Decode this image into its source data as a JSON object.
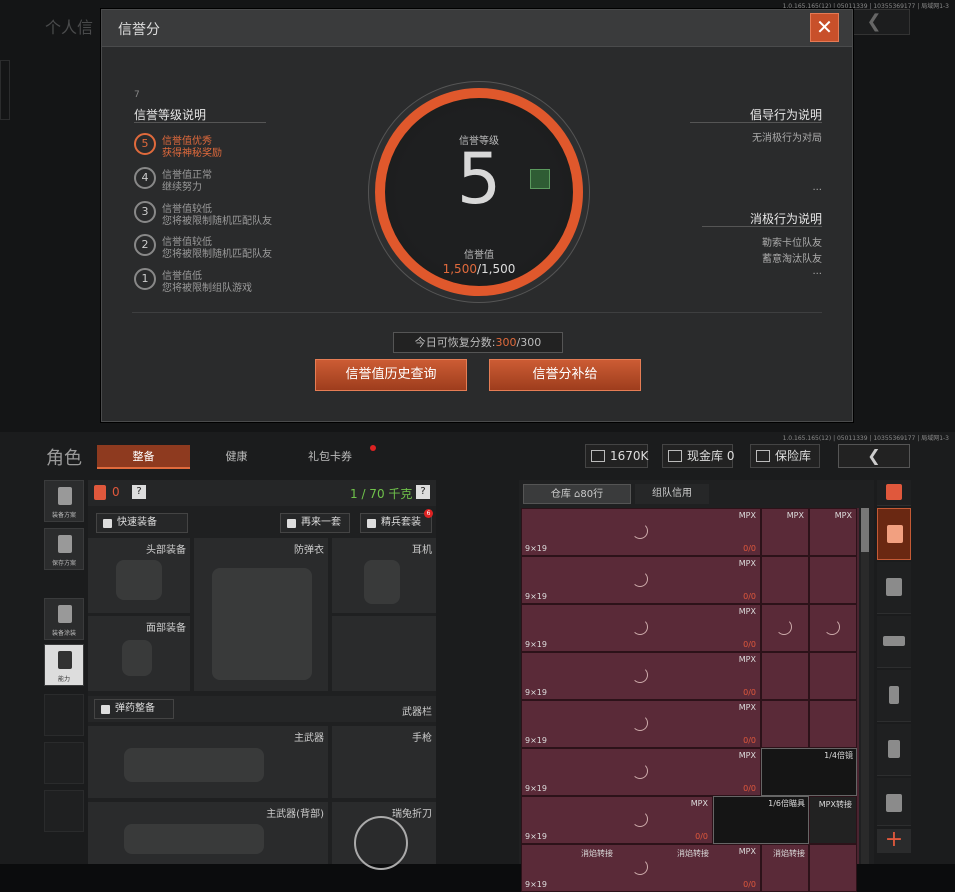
{
  "top": {
    "build_info": "1.0.165.165(12) | 05011339 | 10355369177 | 局域网1-3",
    "bg_title": "个人信"
  },
  "modal": {
    "title": "信誉分",
    "level_section_title": "信誉等级说明",
    "levels": [
      {
        "num": "5",
        "line1": "信誉值优秀",
        "line2": "获得神秘奖励",
        "active": true
      },
      {
        "num": "4",
        "line1": "信誉值正常",
        "line2": "继续努力",
        "active": false
      },
      {
        "num": "3",
        "line1": "信誉值较低",
        "line2": "您将被限制随机匹配队友",
        "active": false
      },
      {
        "num": "2",
        "line1": "信誉值较低",
        "line2": "您将被限制随机匹配队友",
        "active": false
      },
      {
        "num": "1",
        "line1": "信誉值低",
        "line2": "您将被限制组队游戏",
        "active": false
      }
    ],
    "center": {
      "level_label": "信誉等级",
      "level_value": "5",
      "score_label": "信誉值",
      "score_current": "1,500",
      "score_sep_max": "/1,500"
    },
    "positive_title": "倡导行为说明",
    "positive_lines": [
      "无消极行为对局",
      "..."
    ],
    "negative_title": "消极行为说明",
    "negative_lines": [
      "勒索卡位队友",
      "蓄意淘汰队友",
      "..."
    ],
    "recover_prefix": "今日可恢复分数:",
    "recover_current": "300",
    "recover_max": "/300",
    "btn_history": "信誉值历史查询",
    "btn_supplement": "信誉分补给",
    "bg_small_number": "7"
  },
  "bottom": {
    "build_info": "1.0.165.165(12) | 05011339 | 10355369177 | 局域网1-3",
    "role": "角色",
    "tabs": [
      "整备",
      "健康",
      "礼包卡券"
    ],
    "money": "1670K",
    "cash_vault": "现金库 0",
    "safe_box": "保险库",
    "left_side": [
      {
        "label": "装备方案"
      },
      {
        "label": "保存方案"
      },
      {
        "label": "装备涂装"
      },
      {
        "label": "能力"
      }
    ],
    "equip": {
      "item_count": "0",
      "help": "?",
      "weight": "1 / 70 千克",
      "btn_quick": "快速装备",
      "btn_again": "再来一套",
      "btn_elite": "精兵套装",
      "elite_badge": "6",
      "slots": {
        "helmet": "头部装备",
        "vest": "防弹衣",
        "headset": "耳机",
        "face": "面部装备",
        "ammo_btn": "弹药整备",
        "weapon_bar": "武器栏",
        "primary": "主武器",
        "pistol": "手枪",
        "primary_back": "主武器(背部)",
        "melee": "瑞兔折刀"
      }
    },
    "warehouse": {
      "tab_storage": "仓库",
      "tab_rows": "80行",
      "tab_team_credit": "组队信用",
      "caliber": "9×19",
      "mpx": "MPX",
      "count": "0/0",
      "scope": "1/4倍镜",
      "scope2": "1/6倍瞄具",
      "mpx_adapter": "MPX转接",
      "bottom_labels": [
        "消焰转接",
        "消焰转接",
        "消焰转接"
      ]
    }
  }
}
